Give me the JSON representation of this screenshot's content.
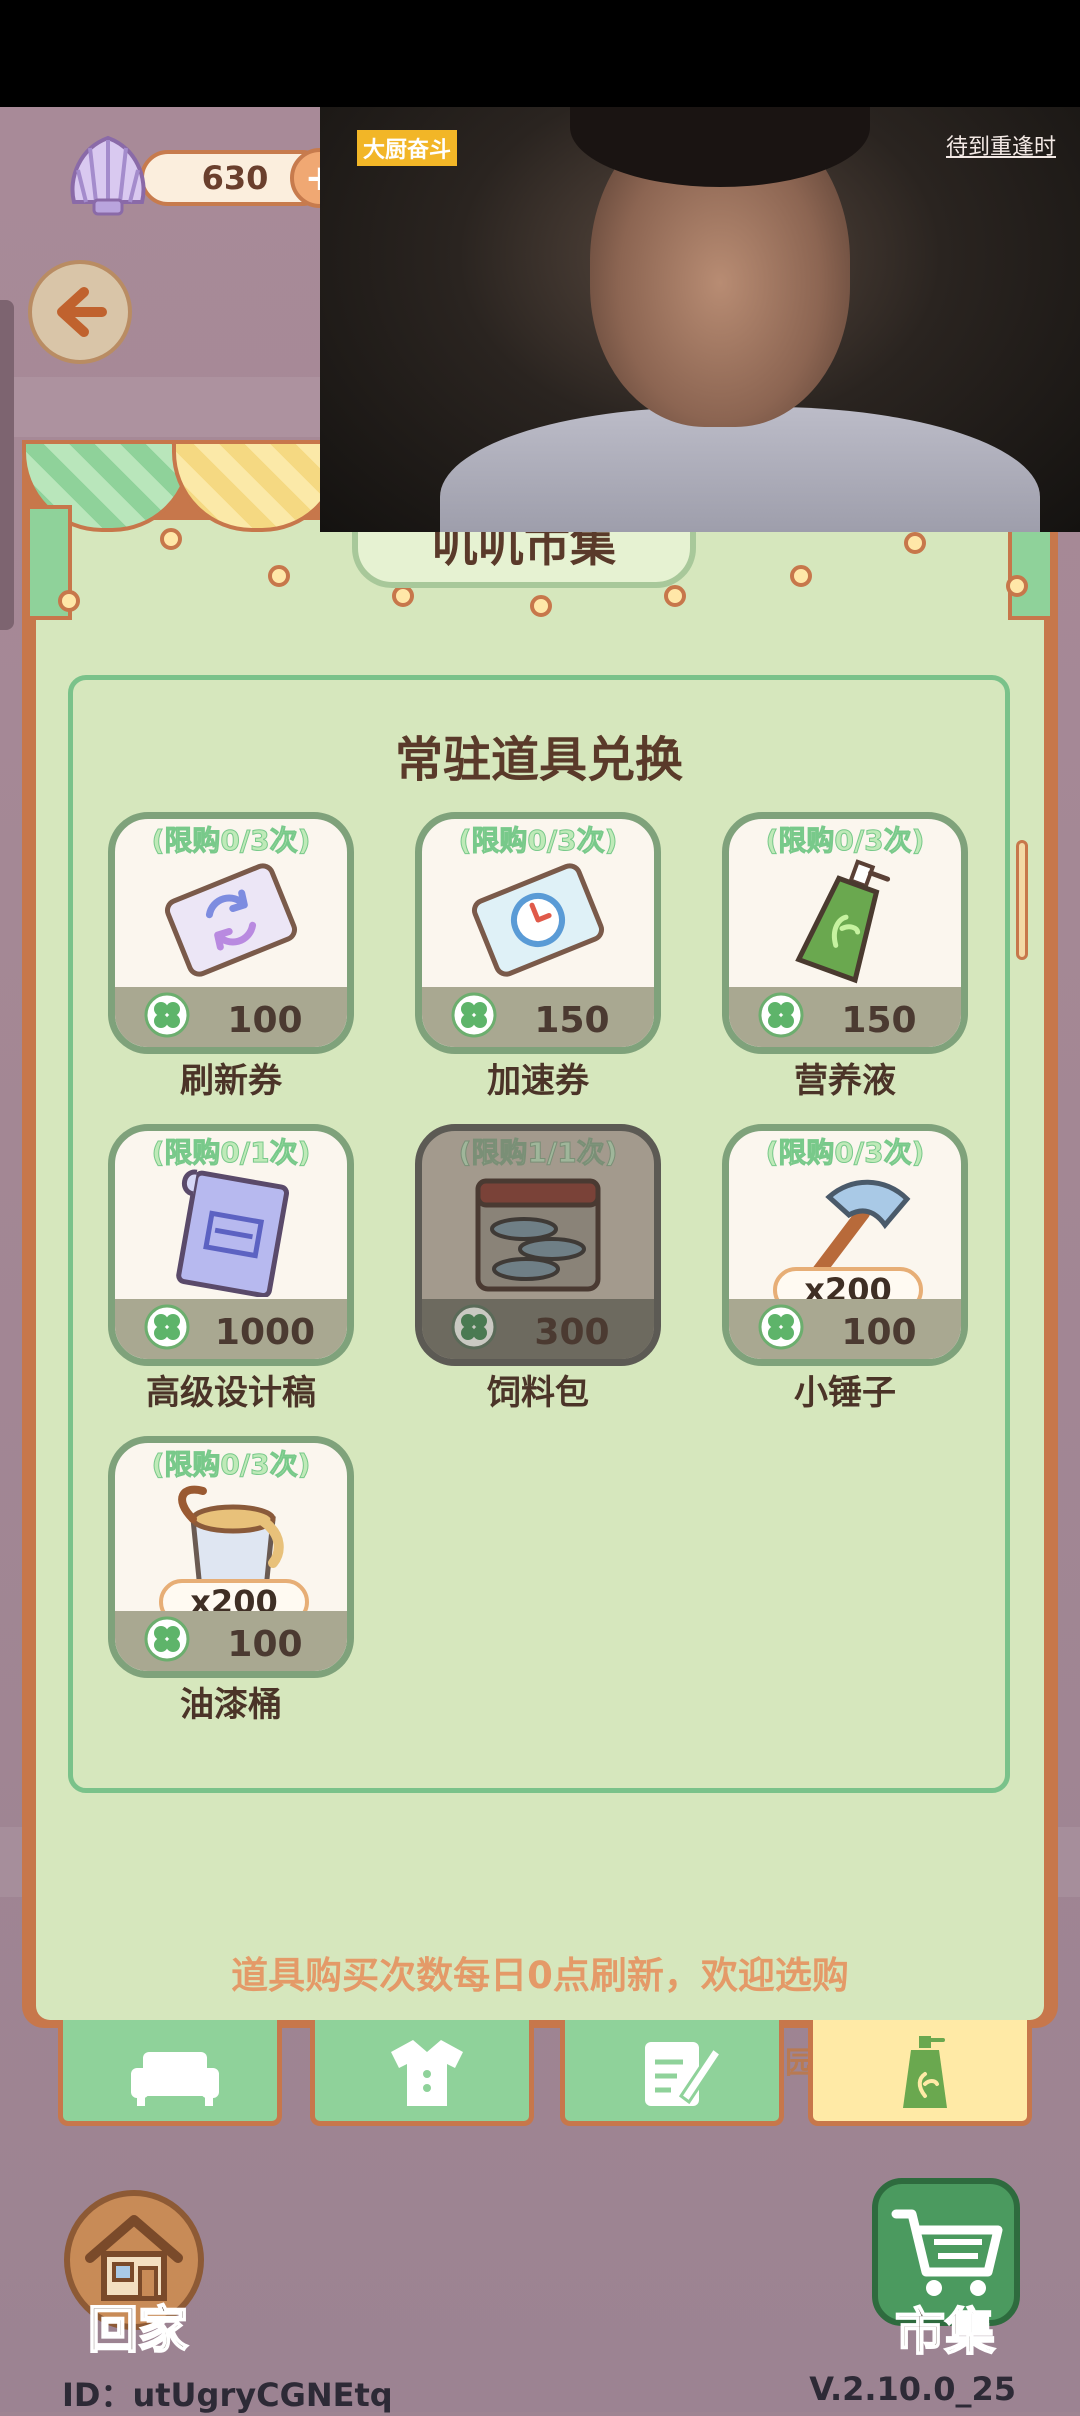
{
  "currency": {
    "shell_count": "630",
    "plus_label": "+"
  },
  "video": {
    "left_badge": "大厨奋斗",
    "right_badge": "待到重逢时"
  },
  "market": {
    "sign_title": "叽叽市集",
    "section_title": "常驻道具兑换",
    "refresh_note": "道具购买次数每日0点刷新，欢迎选购",
    "items": [
      {
        "limit": "(限购0/3次)",
        "price": "100",
        "name": "刷新券",
        "icon": "refresh-ticket-icon",
        "qty": "",
        "sold_out": false
      },
      {
        "limit": "(限购0/3次)",
        "price": "150",
        "name": "加速券",
        "icon": "speedup-ticket-icon",
        "qty": "",
        "sold_out": false
      },
      {
        "limit": "(限购0/3次)",
        "price": "150",
        "name": "营养液",
        "icon": "nutrient-bottle-icon",
        "qty": "",
        "sold_out": false
      },
      {
        "limit": "(限购0/1次)",
        "price": "1000",
        "name": "高级设计稿",
        "icon": "blueprint-icon",
        "qty": "",
        "sold_out": false
      },
      {
        "limit": "(限购1/1次)",
        "price": "300",
        "name": "饲料包",
        "icon": "feed-pack-icon",
        "qty": "",
        "sold_out": true
      },
      {
        "limit": "(限购0/3次)",
        "price": "100",
        "name": "小锤子",
        "icon": "hammer-icon",
        "qty": "x200",
        "sold_out": false
      },
      {
        "limit": "(限购0/3次)",
        "price": "100",
        "name": "油漆桶",
        "icon": "paint-bucket-icon",
        "qty": "x200",
        "sold_out": false
      }
    ]
  },
  "tabs": [
    {
      "name": "furniture-tab",
      "icon": "sofa-icon",
      "active": false
    },
    {
      "name": "clothing-tab",
      "icon": "shirt-icon",
      "active": false
    },
    {
      "name": "design-tab",
      "icon": "pen-note-icon",
      "active": false
    },
    {
      "name": "props-tab",
      "icon": "bottle-icon",
      "active": true
    }
  ],
  "tab_hidden_label": "园",
  "bottom_nav": {
    "home_label": "回家",
    "market_label": "市集"
  },
  "footer": {
    "user_id": "ID：utUgryCGNEtq",
    "version": "V.2.10.0_25"
  },
  "colors": {
    "panel_green": "#d6e7bd",
    "frame_brown": "#c7774b",
    "accent_green": "#8fd29a",
    "note_orange": "#e49a68"
  }
}
